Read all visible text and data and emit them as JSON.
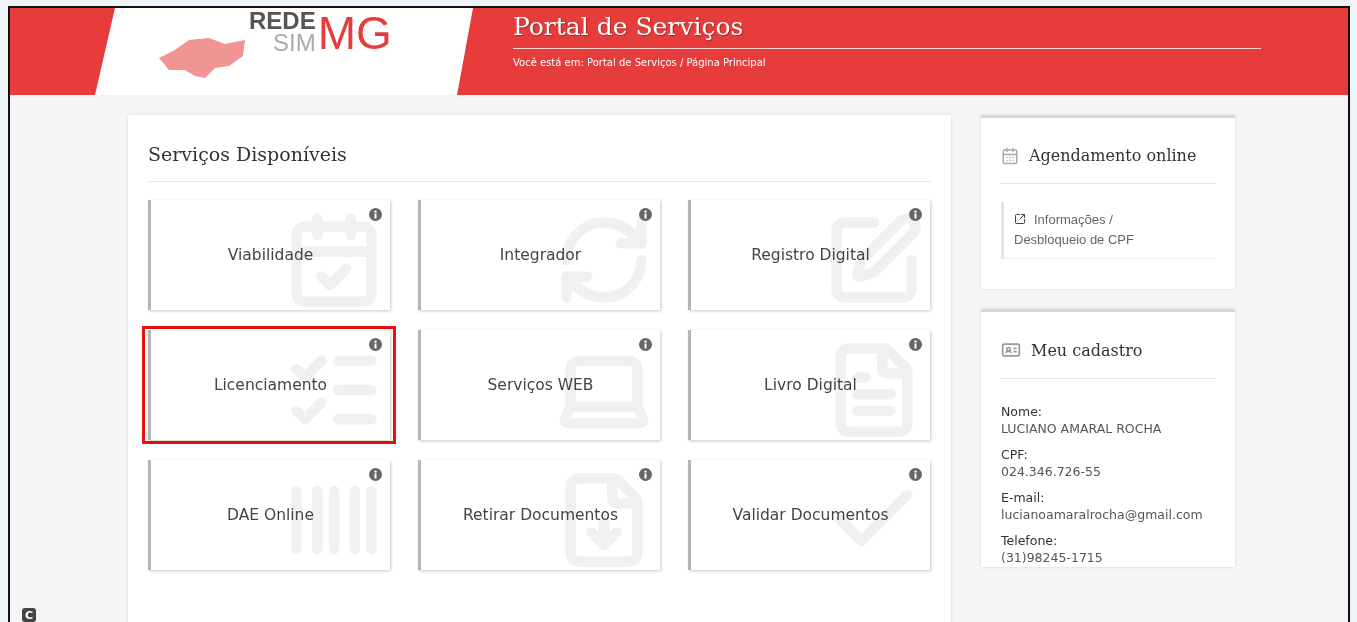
{
  "header": {
    "logo": {
      "line_1": "REDE",
      "line_2": "SIM",
      "mark": "MG"
    },
    "title": "Portal de Serviços",
    "breadcrumb": "Você está em: Portal de Serviços / Página Principal"
  },
  "services": {
    "heading": "Serviços Disponíveis",
    "tiles": [
      {
        "label": "Viabilidade",
        "highlighted": false
      },
      {
        "label": "Integrador",
        "highlighted": false
      },
      {
        "label": "Registro Digital",
        "highlighted": false
      },
      {
        "label": "Licenciamento",
        "highlighted": true
      },
      {
        "label": "Serviços WEB",
        "highlighted": false
      },
      {
        "label": "Livro Digital",
        "highlighted": false
      },
      {
        "label": "DAE Online",
        "highlighted": false
      },
      {
        "label": "Retirar Documentos",
        "highlighted": false
      },
      {
        "label": "Validar Documentos",
        "highlighted": false
      }
    ]
  },
  "scheduling": {
    "title": "Agendamento online",
    "link": "Informações / Desbloqueio de CPF"
  },
  "profile": {
    "title": "Meu cadastro",
    "fields": [
      {
        "label": "Nome:",
        "value": "LUCIANO AMARAL ROCHA"
      },
      {
        "label": "CPF:",
        "value": "024.346.726-55"
      },
      {
        "label": "E-mail:",
        "value": "lucianoamaralrocha@gmail.com"
      },
      {
        "label": "Telefone:",
        "value": "(31)98245-1715"
      }
    ]
  },
  "corner_badge": "C"
}
